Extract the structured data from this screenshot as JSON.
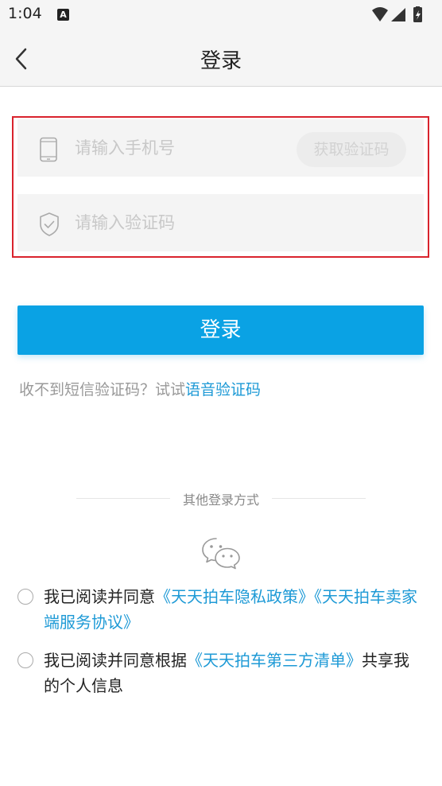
{
  "status": {
    "time": "1:04",
    "badge": "A"
  },
  "header": {
    "title": "登录"
  },
  "form": {
    "phone_placeholder": "请输入手机号",
    "get_code_label": "获取验证码",
    "code_placeholder": "请输入验证码",
    "login_label": "登录"
  },
  "hint": {
    "prefix": "收不到短信验证码？试试",
    "link": "语音验证码"
  },
  "other": {
    "label": "其他登录方式"
  },
  "agreements": [
    {
      "prefix": "我已阅读并同意",
      "link1": "《天天拍车隐私政策》",
      "link2": "《天天拍车卖家端服务协议》",
      "suffix": ""
    },
    {
      "prefix": "我已阅读并同意根据",
      "link1": "《天天拍车第三方清单》",
      "suffix": "共享我的个人信息"
    }
  ],
  "colors": {
    "accent": "#0aa2e4",
    "link": "#1e9ad6",
    "highlight": "#d9232d"
  },
  "icons": [
    "phone-icon",
    "shield-check-icon",
    "wechat-icon",
    "back-icon",
    "wifi-icon",
    "signal-icon",
    "battery-icon"
  ]
}
